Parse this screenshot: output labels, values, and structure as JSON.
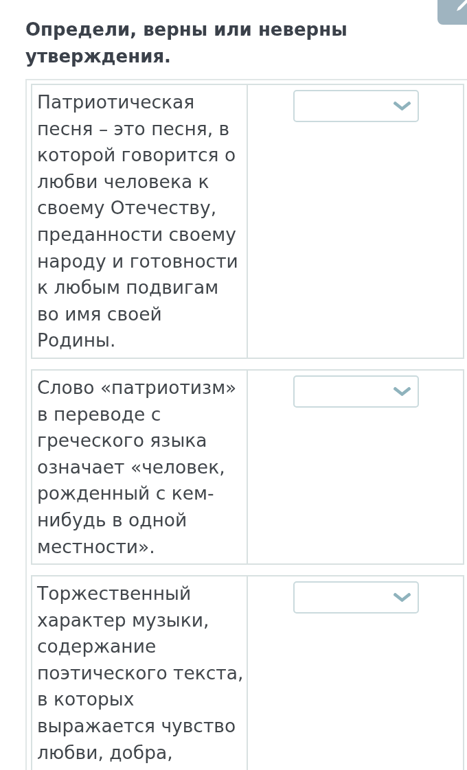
{
  "instruction": "Определи, верны или неверны утверждения.",
  "statements": [
    {
      "text": "Патриотическая песня – это песня, в которой говорится о любви человека к своему Отечеству, преданности своему народу и готовности к любым подвигам во имя своей Родины."
    },
    {
      "text": "Слово «патриотизм» в переводе с греческого языка означает «человек, рожденный с кем-нибудь в одной местности»."
    },
    {
      "text": "Торжественный характер музыки, содержание поэтического текста, в которых выражается чувство любви, добра,"
    }
  ]
}
